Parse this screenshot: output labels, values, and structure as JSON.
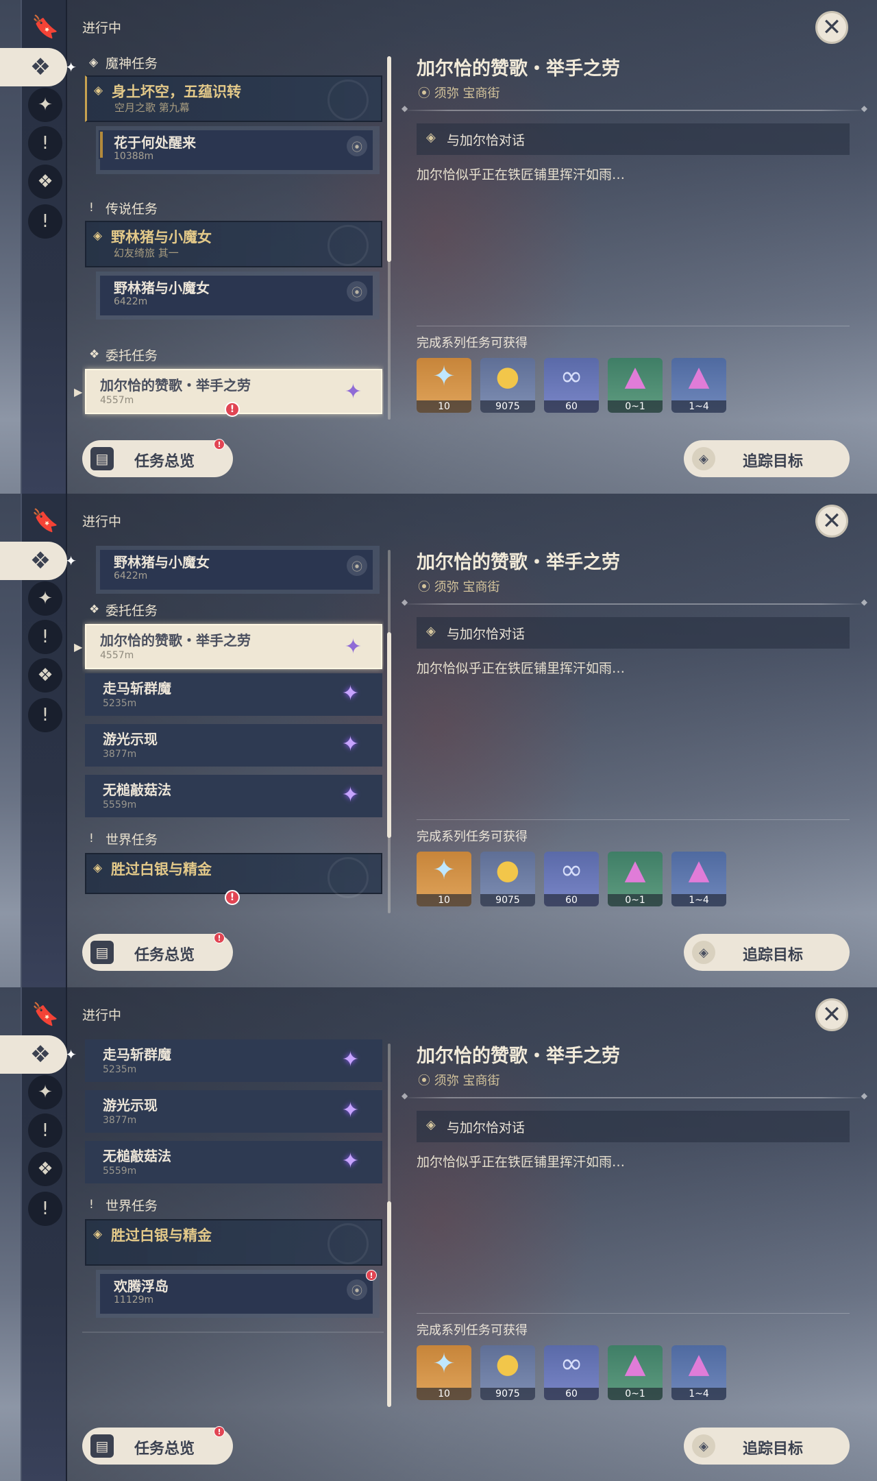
{
  "header": {
    "in_progress": "进行中",
    "close_icon": "✕"
  },
  "nav": {
    "icons": [
      "bookmark-icon",
      "archon-quest-icon",
      "story-quest-icon",
      "legend-quest-icon",
      "commission-icon",
      "world-quest-icon"
    ]
  },
  "categories": {
    "archon": "魔神任务",
    "legend": "传说任务",
    "commission": "委托任务",
    "world": "世界任务"
  },
  "quests": {
    "archon_main": {
      "title": "身土坏空，五蕴识转",
      "subtitle": "空月之歌 第九幕"
    },
    "archon_sub": {
      "title": "花于何处醒来",
      "distance": "10388m"
    },
    "legend_main": {
      "title": "野林猪与小魔女",
      "subtitle": "幻友绮旅 其一"
    },
    "legend_sub": {
      "title": "野林猪与小魔女",
      "distance": "6422m"
    },
    "c1": {
      "title": "加尔恰的赞歌・举手之劳",
      "distance": "4557m"
    },
    "c2": {
      "title": "走马斩群魔",
      "distance": "5235m"
    },
    "c3": {
      "title": "游光示现",
      "distance": "3877m"
    },
    "c4": {
      "title": "无槌敲菇法",
      "distance": "5559m"
    },
    "world_main": {
      "title": "胜过白银与精金"
    },
    "world_sub": {
      "title": "欢腾浮岛",
      "distance": "11129m"
    }
  },
  "alert_mark": "!",
  "buttons": {
    "overview": "任务总览",
    "track": "追踪目标"
  },
  "detail": {
    "title": "加尔恰的赞歌・举手之劳",
    "location": "须弥 宝商街",
    "step": "与加尔恰对话",
    "description": "加尔恰似乎正在铁匠铺里挥汗如雨…",
    "rewards_label": "完成系列任务可获得",
    "rewards": [
      {
        "icon": "primogem-icon",
        "count": "10"
      },
      {
        "icon": "mora-icon",
        "count": "9075"
      },
      {
        "icon": "adventure-exp-icon",
        "count": "60"
      },
      {
        "icon": "crystal-chunk-icon",
        "count": "0~1"
      },
      {
        "icon": "crystal-cluster-icon",
        "count": "1~4"
      }
    ]
  },
  "colors": {
    "accent_gold": "#e3c989",
    "panel_light": "#ece5d8",
    "alert_red": "#e14553",
    "commission_purple": "#c7a4ff"
  }
}
